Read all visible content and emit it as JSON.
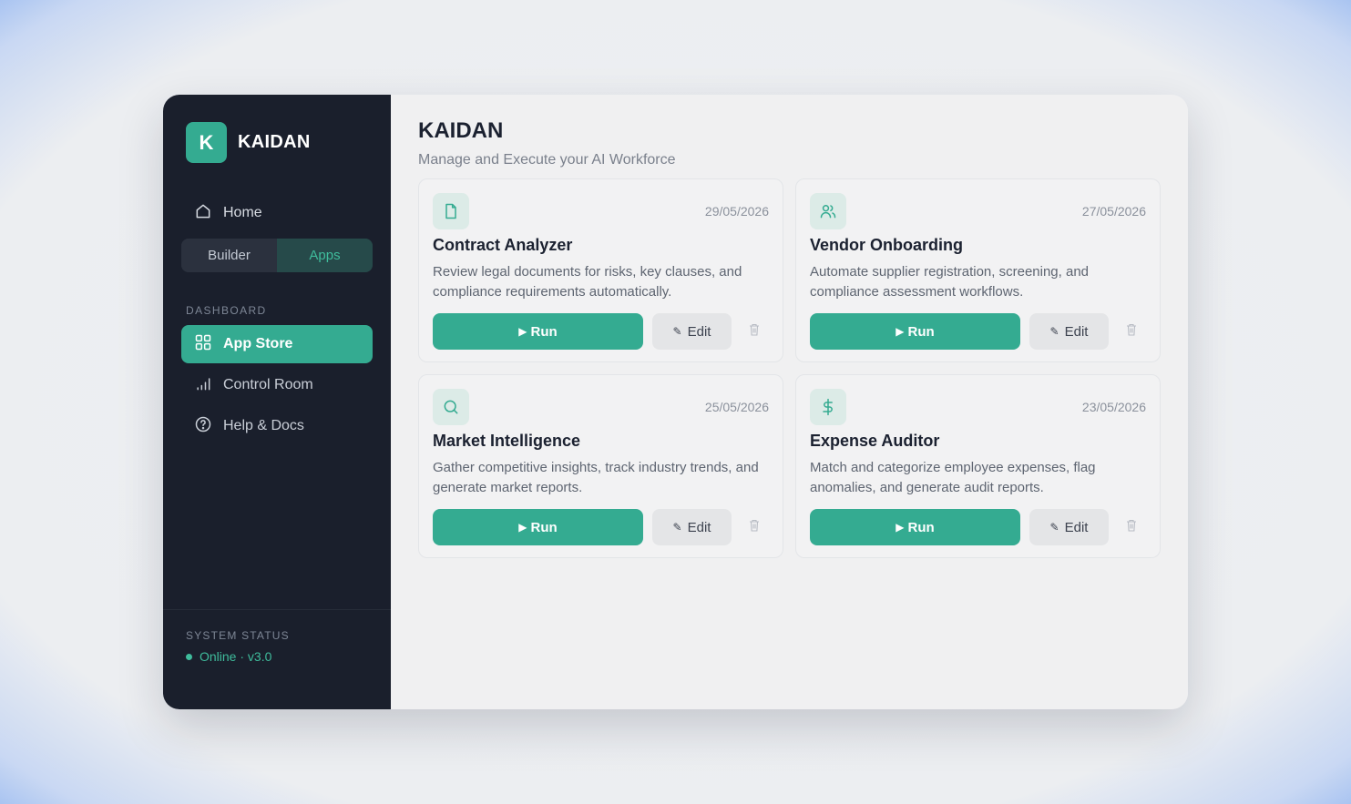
{
  "brand": {
    "logo_letter": "K",
    "name": "KAIDAN"
  },
  "sidebar": {
    "home_label": "Home",
    "segments": [
      {
        "label": "Builder",
        "active": false
      },
      {
        "label": "Apps",
        "active": true
      }
    ],
    "section_label": "DASHBOARD",
    "items": [
      {
        "label": "App Store",
        "icon": "grid-icon",
        "active": true
      },
      {
        "label": "Control Room",
        "icon": "bars-icon",
        "active": false
      },
      {
        "label": "Help & Docs",
        "icon": "help-icon",
        "active": false
      }
    ],
    "status_label": "SYSTEM STATUS",
    "status_value": "Online · v3.0"
  },
  "main": {
    "title": "KAIDAN",
    "subtitle": "Manage and Execute your AI Workforce",
    "cards": [
      {
        "title": "Contract Analyzer",
        "date": "29/05/2026",
        "icon": "document-icon",
        "description": "Review legal documents for risks, key clauses, and compliance requirements automatically."
      },
      {
        "title": "Vendor Onboarding",
        "date": "27/05/2026",
        "icon": "users-icon",
        "description": "Automate supplier registration, screening, and compliance assessment workflows."
      },
      {
        "title": "Market Intelligence",
        "date": "25/05/2026",
        "icon": "search-icon",
        "description": "Gather competitive insights, track industry trends, and generate market reports."
      },
      {
        "title": "Expense Auditor",
        "date": "23/05/2026",
        "icon": "dollar-icon",
        "description": "Match and categorize employee expenses, flag anomalies, and generate audit reports."
      }
    ],
    "run_label": "Run",
    "edit_label": "Edit"
  },
  "colors": {
    "accent": "#34ab91",
    "sidebar_bg": "#1a1f2c",
    "main_bg": "#f0f0f1"
  }
}
